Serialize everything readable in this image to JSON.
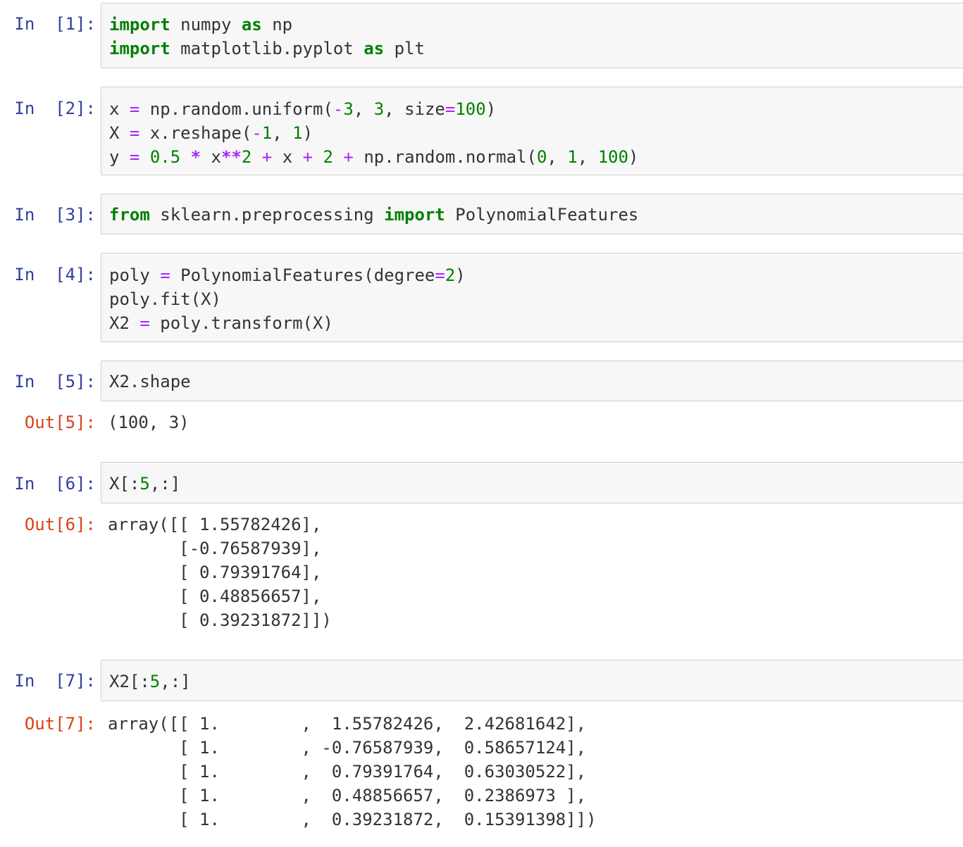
{
  "cells": [
    {
      "prompt": "In  [1]:",
      "lines": [
        [
          {
            "t": "import",
            "c": "kw"
          },
          {
            "t": " numpy ",
            "c": ""
          },
          {
            "t": "as",
            "c": "kw"
          },
          {
            "t": " np",
            "c": ""
          }
        ],
        [
          {
            "t": "import",
            "c": "kw"
          },
          {
            "t": " matplotlib.pyplot ",
            "c": ""
          },
          {
            "t": "as",
            "c": "kw"
          },
          {
            "t": " plt",
            "c": ""
          }
        ]
      ]
    },
    {
      "prompt": "In  [2]:",
      "lines": [
        [
          {
            "t": "x ",
            "c": ""
          },
          {
            "t": "=",
            "c": "op"
          },
          {
            "t": " np.random.uniform(",
            "c": ""
          },
          {
            "t": "-",
            "c": "op"
          },
          {
            "t": "3",
            "c": "num"
          },
          {
            "t": ", ",
            "c": ""
          },
          {
            "t": "3",
            "c": "num"
          },
          {
            "t": ", size",
            "c": ""
          },
          {
            "t": "=",
            "c": "op"
          },
          {
            "t": "100",
            "c": "num"
          },
          {
            "t": ")",
            "c": ""
          }
        ],
        [
          {
            "t": "X ",
            "c": ""
          },
          {
            "t": "=",
            "c": "op"
          },
          {
            "t": " x.reshape(",
            "c": ""
          },
          {
            "t": "-",
            "c": "op"
          },
          {
            "t": "1",
            "c": "num"
          },
          {
            "t": ", ",
            "c": ""
          },
          {
            "t": "1",
            "c": "num"
          },
          {
            "t": ")",
            "c": ""
          }
        ],
        [
          {
            "t": "y ",
            "c": ""
          },
          {
            "t": "=",
            "c": "op"
          },
          {
            "t": " ",
            "c": ""
          },
          {
            "t": "0.5",
            "c": "num"
          },
          {
            "t": " ",
            "c": ""
          },
          {
            "t": "*",
            "c": "opb"
          },
          {
            "t": " x",
            "c": ""
          },
          {
            "t": "**",
            "c": "opb"
          },
          {
            "t": "2",
            "c": "num"
          },
          {
            "t": " ",
            "c": ""
          },
          {
            "t": "+",
            "c": "op"
          },
          {
            "t": " x ",
            "c": ""
          },
          {
            "t": "+",
            "c": "op"
          },
          {
            "t": " ",
            "c": ""
          },
          {
            "t": "2",
            "c": "num"
          },
          {
            "t": " ",
            "c": ""
          },
          {
            "t": "+",
            "c": "op"
          },
          {
            "t": " np.random.normal(",
            "c": ""
          },
          {
            "t": "0",
            "c": "num"
          },
          {
            "t": ", ",
            "c": ""
          },
          {
            "t": "1",
            "c": "num"
          },
          {
            "t": ", ",
            "c": ""
          },
          {
            "t": "100",
            "c": "num"
          },
          {
            "t": ")",
            "c": ""
          }
        ]
      ]
    },
    {
      "prompt": "In  [3]:",
      "lines": [
        [
          {
            "t": "from",
            "c": "kw"
          },
          {
            "t": " sklearn.preprocessing ",
            "c": ""
          },
          {
            "t": "import",
            "c": "kw"
          },
          {
            "t": " PolynomialFeatures",
            "c": ""
          }
        ]
      ]
    },
    {
      "prompt": "In  [4]:",
      "lines": [
        [
          {
            "t": "poly ",
            "c": ""
          },
          {
            "t": "=",
            "c": "op"
          },
          {
            "t": " PolynomialFeatures(degree",
            "c": ""
          },
          {
            "t": "=",
            "c": "op"
          },
          {
            "t": "2",
            "c": "num"
          },
          {
            "t": ")",
            "c": ""
          }
        ],
        [
          {
            "t": "poly.fit(X)",
            "c": ""
          }
        ],
        [
          {
            "t": "X2 ",
            "c": ""
          },
          {
            "t": "=",
            "c": "op"
          },
          {
            "t": " poly.transform(X)",
            "c": ""
          }
        ]
      ]
    },
    {
      "prompt": "In  [5]:",
      "lines": [
        [
          {
            "t": "X2.shape",
            "c": ""
          }
        ]
      ],
      "out_prompt": "Out[5]:",
      "output": [
        "(100, 3)"
      ]
    },
    {
      "prompt": "In  [6]:",
      "lines": [
        [
          {
            "t": "X[:",
            "c": ""
          },
          {
            "t": "5",
            "c": "num"
          },
          {
            "t": ",:]",
            "c": ""
          }
        ]
      ],
      "out_prompt": "Out[6]:",
      "output": [
        "array([[ 1.55782426],",
        "       [-0.76587939],",
        "       [ 0.79391764],",
        "       [ 0.48856657],",
        "       [ 0.39231872]])"
      ]
    },
    {
      "prompt": "In  [7]:",
      "lines": [
        [
          {
            "t": "X2[:",
            "c": ""
          },
          {
            "t": "5",
            "c": "num"
          },
          {
            "t": ",:]",
            "c": ""
          }
        ]
      ],
      "out_prompt": "Out[7]:",
      "output": [
        "array([[ 1.        ,  1.55782426,  2.42681642],",
        "       [ 1.        , -0.76587939,  0.58657124],",
        "       [ 1.        ,  0.79391764,  0.63030522],",
        "       [ 1.        ,  0.48856657,  0.2386973 ],",
        "       [ 1.        ,  0.39231872,  0.15391398]])"
      ]
    }
  ]
}
